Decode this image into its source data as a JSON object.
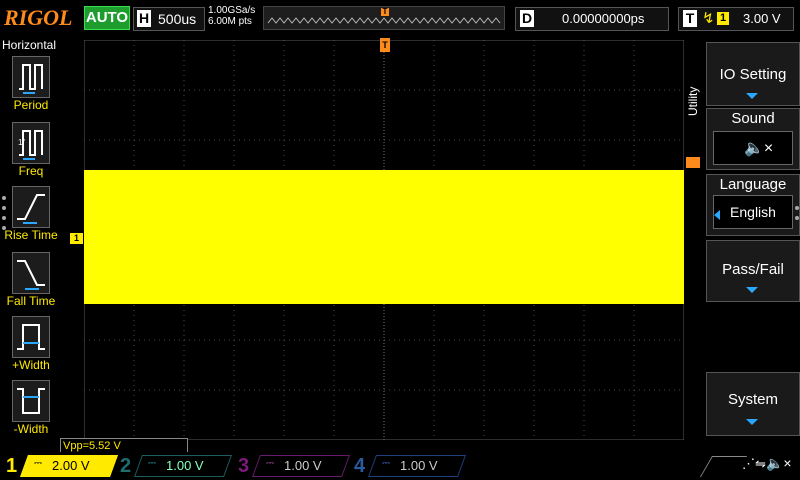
{
  "brand": "RIGOL",
  "top": {
    "run_status": "AUTO",
    "horizontal": {
      "key": "H",
      "value": "500us"
    },
    "sample_rate": "1.00GSa/s",
    "memory_depth": "6.00M pts",
    "delay": {
      "key": "D",
      "value": "0.00000000ps"
    },
    "trigger": {
      "key": "T",
      "source": "1",
      "level": "3.00 V"
    }
  },
  "left_menu": {
    "title": "Horizontal",
    "items": [
      {
        "label": "Period"
      },
      {
        "label": "Freq"
      },
      {
        "label": "Rise Time"
      },
      {
        "label": "Fall Time"
      },
      {
        "label": "+Width"
      },
      {
        "label": "-Width"
      }
    ]
  },
  "measurement": {
    "vpp": "Vpp=5.52 V"
  },
  "right_menu": {
    "title": "Utility",
    "io_setting": "IO Setting",
    "sound": "Sound",
    "language": "Language",
    "language_value": "English",
    "pass_fail": "Pass/Fail",
    "system": "System"
  },
  "channels": [
    {
      "num": "1",
      "value": "2.00 V",
      "color": "#ffea00"
    },
    {
      "num": "2",
      "value": "1.00 V",
      "color": "#1fc8c8"
    },
    {
      "num": "3",
      "value": "1.00 V",
      "color": "#d81ad8"
    },
    {
      "num": "4",
      "value": "1.00 V",
      "color": "#2a7fff"
    }
  ],
  "markers": {
    "trigger_pos": "T",
    "ch1_ref": "1"
  },
  "colors": {
    "ch1": "#ffff00",
    "trigger": "#ff8a1c",
    "grid": "#4a4a4a"
  }
}
